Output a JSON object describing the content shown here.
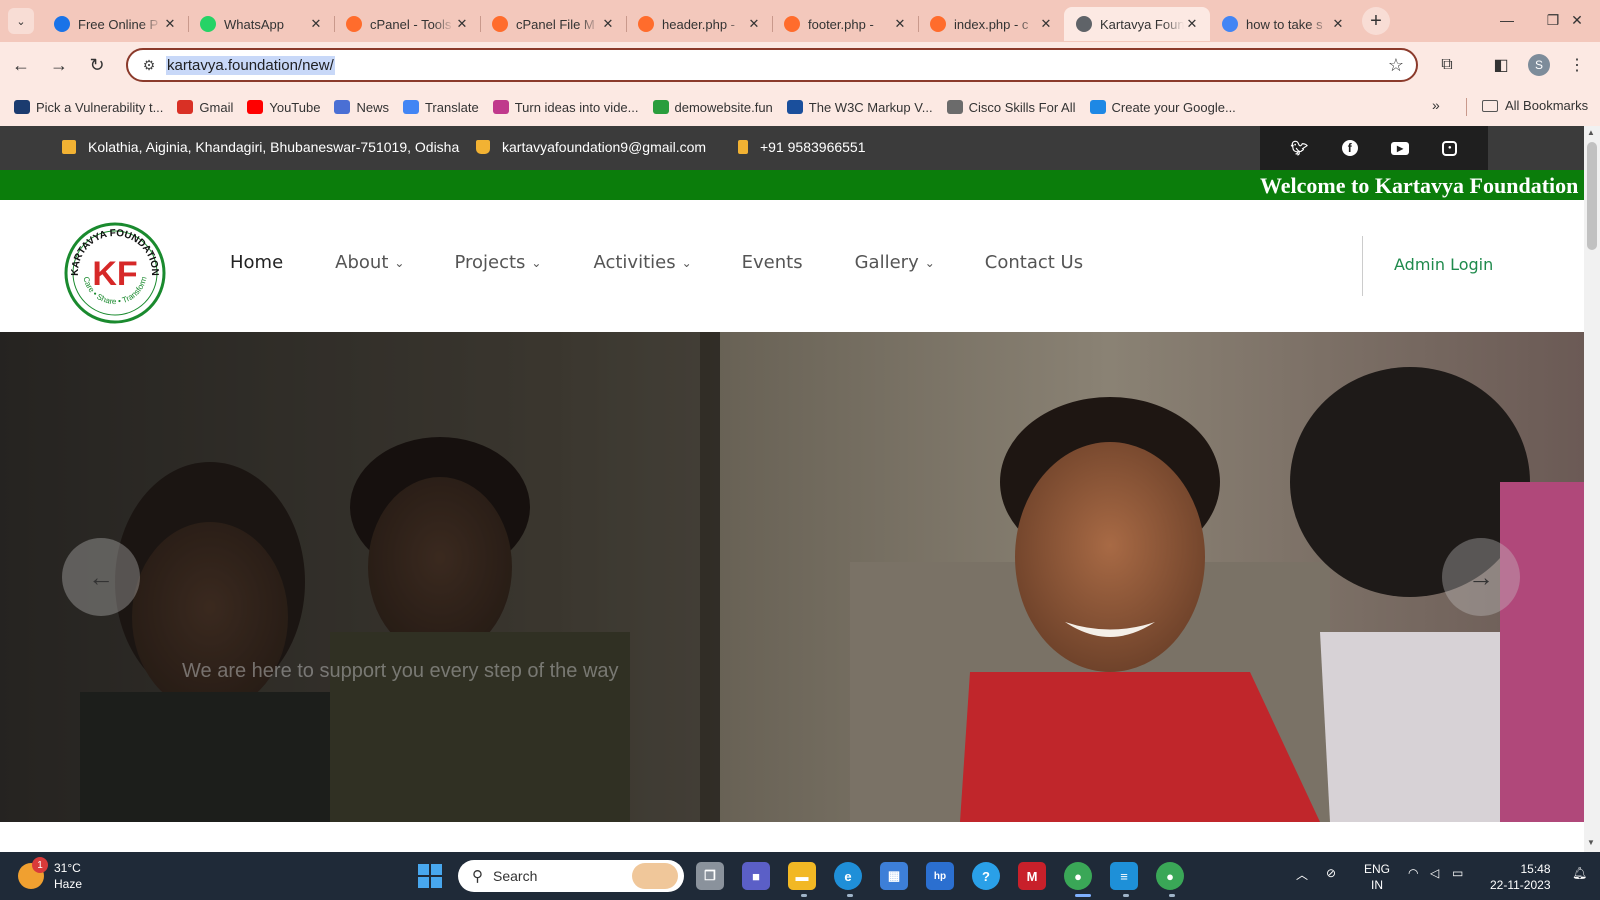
{
  "browser": {
    "tabs": [
      {
        "title": "Free Online P",
        "favicon": "circle-c-icon",
        "color": "#1a73e8"
      },
      {
        "title": "WhatsApp",
        "favicon": "whatsapp-icon",
        "color": "#25d366"
      },
      {
        "title": "cPanel - Tools",
        "favicon": "cpanel-icon",
        "color": "#ff6c2c"
      },
      {
        "title": "cPanel File M",
        "favicon": "cpanel-icon",
        "color": "#ff6c2c"
      },
      {
        "title": "header.php -",
        "favicon": "cpanel-icon",
        "color": "#ff6c2c"
      },
      {
        "title": "footer.php -",
        "favicon": "cpanel-icon",
        "color": "#ff6c2c"
      },
      {
        "title": "index.php - c",
        "favicon": "cpanel-icon",
        "color": "#ff6c2c"
      },
      {
        "title": "Kartavya Foun",
        "favicon": "globe-icon",
        "color": "#5f6368",
        "active": true
      },
      {
        "title": "how to take s",
        "favicon": "google-icon",
        "color": "#4285f4"
      }
    ],
    "url": "kartavya.foundation/new/",
    "bookmarks": [
      {
        "label": "Pick a Vulnerability t...",
        "icon": "ha-icon",
        "color": "#1b3b6f"
      },
      {
        "label": "Gmail",
        "icon": "gmail-icon",
        "color": "#d93025"
      },
      {
        "label": "YouTube",
        "icon": "youtube-icon",
        "color": "#ff0000"
      },
      {
        "label": "News",
        "icon": "news-icon",
        "color": "#4a6fd4"
      },
      {
        "label": "Translate",
        "icon": "translate-icon",
        "color": "#4285f4"
      },
      {
        "label": "Turn ideas into vide...",
        "icon": "video-icon",
        "color": "#c0398c"
      },
      {
        "label": "demowebsite.fun",
        "icon": "demo-icon",
        "color": "#2a9d3c"
      },
      {
        "label": "The W3C Markup V...",
        "icon": "w3c-icon",
        "color": "#1a4f9c"
      },
      {
        "label": "Cisco Skills For All",
        "icon": "cisco-icon",
        "color": "#6b6b6b"
      },
      {
        "label": "Create your Google...",
        "icon": "google-sites-icon",
        "color": "#1e88e5"
      }
    ],
    "all_bookmarks": "All Bookmarks",
    "profile_initial": "S"
  },
  "site": {
    "topbar": {
      "address": "Kolathia, Aiginia, Khandagiri, Bhubaneswar-751019, Odisha",
      "email": "kartavyafoundation9@gmail.com",
      "phone": "+91 9583966551",
      "social": [
        "twitter-icon",
        "facebook-icon",
        "youtube-icon",
        "instagram-icon"
      ]
    },
    "marquee": "Welcome to Kartavya Foundation",
    "logo": {
      "ring_text": "KARTAVYA FOUNDATION",
      "tagline": "Care • Share • Transform",
      "letters": "KF"
    },
    "nav": [
      {
        "label": "Home",
        "dropdown": false
      },
      {
        "label": "About",
        "dropdown": true
      },
      {
        "label": "Projects",
        "dropdown": true
      },
      {
        "label": "Activities",
        "dropdown": true
      },
      {
        "label": "Events",
        "dropdown": false
      },
      {
        "label": "Gallery",
        "dropdown": true
      },
      {
        "label": "Contact Us",
        "dropdown": false
      }
    ],
    "admin_login": "Admin Login",
    "hero": {
      "caption": "We are here to support you every step of the way",
      "prev_icon": "arrow-left-icon",
      "next_icon": "arrow-right-icon"
    },
    "colors": {
      "marquee_bg": "#0b7d0b",
      "topbar_bg": "#3b3b3b",
      "admin_link": "#1f8a4c"
    }
  },
  "taskbar": {
    "weather": {
      "temp": "31°C",
      "condition": "Haze",
      "badge": "1"
    },
    "search_placeholder": "Search",
    "lang_top": "ENG",
    "lang_bottom": "IN",
    "time": "15:48",
    "date": "22-11-2023"
  }
}
